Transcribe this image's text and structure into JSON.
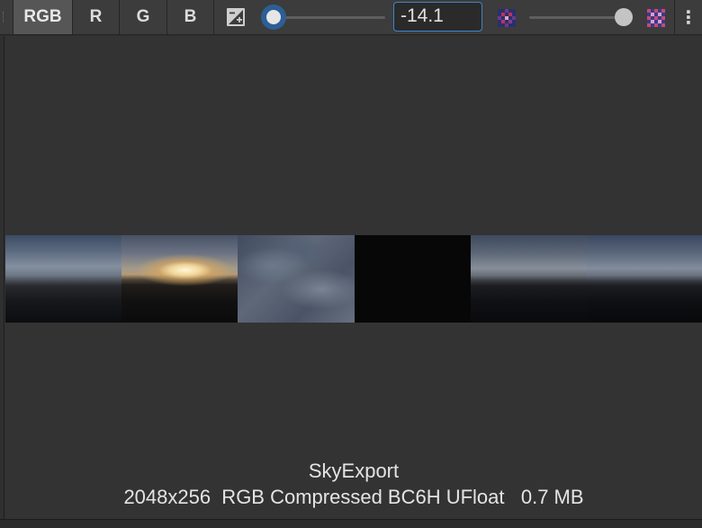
{
  "toolbar": {
    "channels": [
      {
        "label": "RGB",
        "active": true
      },
      {
        "label": "R",
        "active": false
      },
      {
        "label": "G",
        "active": false
      },
      {
        "label": "B",
        "active": false
      }
    ],
    "exposure_icon": "exposure-icon",
    "exposure_value": "-14.1",
    "exposure_slider_level": 0.0,
    "mip_small_icon": "checker-small-icon",
    "mip_large_icon": "checker-large-icon",
    "mip_slider_level": 1.0,
    "more_icon": "vertical-ellipsis-icon",
    "more_glyph": "⋮"
  },
  "preview": {
    "asset_name": "SkyExport",
    "asset_details": "2048x256  RGB Compressed BC6H UFloat   0.7 MB"
  },
  "colors": {
    "toolbar_bg": "#3c3c3c",
    "active_channel_bg": "#565656",
    "accent_blue": "#3f84c9",
    "slider_knob_ring": "#2c5f95",
    "panel_bg": "#333333",
    "text": "#e4e4e4"
  }
}
